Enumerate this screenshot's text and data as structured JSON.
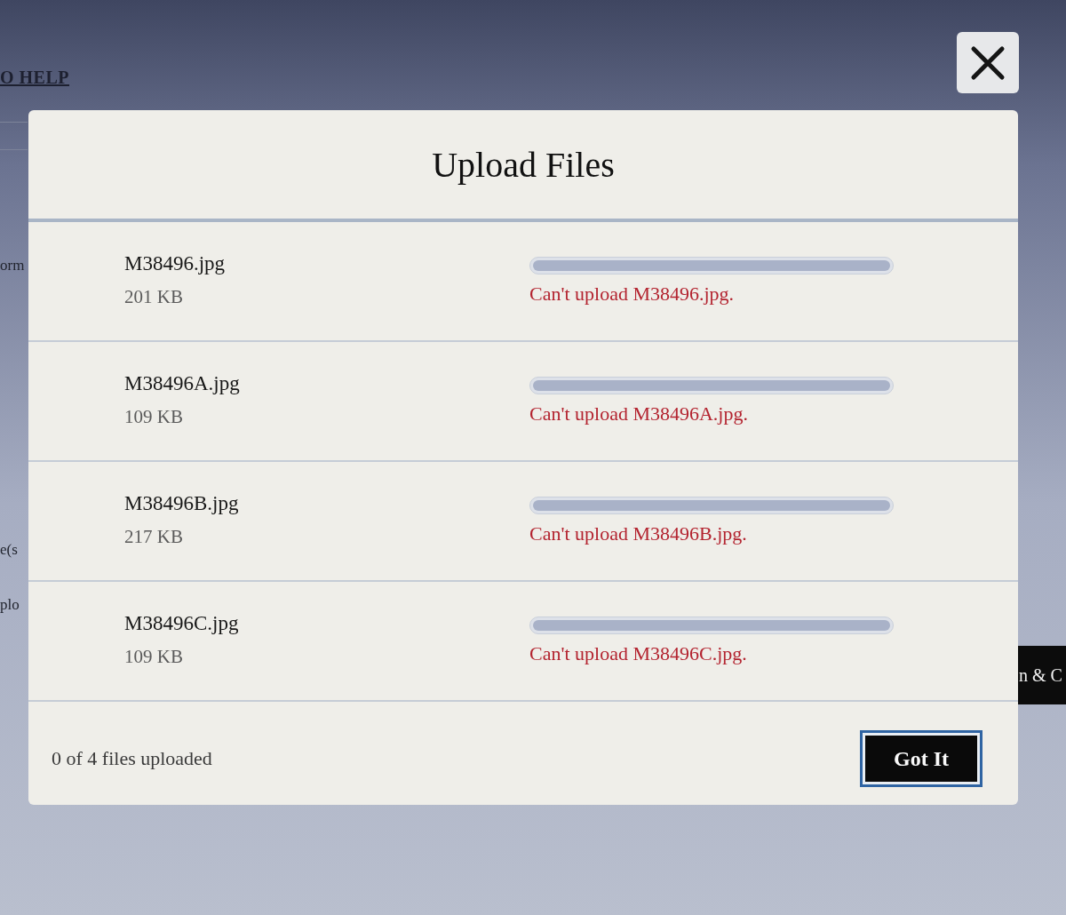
{
  "background_page": {
    "help_link": "O HELP",
    "left_fragments": [
      "orm",
      "e(s",
      "plo"
    ],
    "right_button": "n & C"
  },
  "dialog": {
    "title": "Upload Files",
    "files": [
      {
        "name": "M38496.jpg",
        "size": "201 KB",
        "level": 1,
        "error": "Can't upload M38496.jpg."
      },
      {
        "name": "M38496A.jpg",
        "size": "109 KB",
        "level": 1,
        "error": "Can't upload M38496A.jpg."
      },
      {
        "name": "M38496B.jpg",
        "size": "217 KB",
        "level": 1,
        "error": "Can't upload M38496B.jpg."
      },
      {
        "name": "M38496C.jpg",
        "size": "109 KB",
        "level": 1,
        "error": "Can't upload M38496C.jpg."
      }
    ],
    "status": "0 of 4 files uploaded",
    "button": "Got It"
  }
}
